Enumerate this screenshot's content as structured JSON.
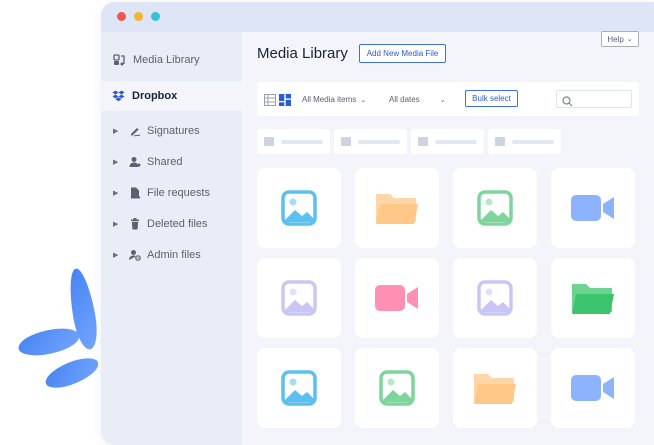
{
  "window": {
    "controls": [
      {
        "name": "close",
        "color": "#f5564a"
      },
      {
        "name": "minimize",
        "color": "#f3b62a"
      },
      {
        "name": "maximize",
        "color": "#35c2d8"
      }
    ]
  },
  "sidebar": {
    "items": [
      {
        "label": "Media Library",
        "icon": "media-library-icon",
        "active": false,
        "expandable": false
      },
      {
        "label": "Dropbox",
        "icon": "dropbox-icon",
        "active": true,
        "expandable": false
      },
      {
        "label": "Signatures",
        "icon": "signature-icon",
        "active": false,
        "expandable": true
      },
      {
        "label": "Shared",
        "icon": "shared-user-icon",
        "active": false,
        "expandable": true
      },
      {
        "label": "File requests",
        "icon": "file-request-icon",
        "active": false,
        "expandable": true
      },
      {
        "label": "Deleted files",
        "icon": "trash-icon",
        "active": false,
        "expandable": true
      },
      {
        "label": "Admin files",
        "icon": "admin-user-icon",
        "active": false,
        "expandable": true
      }
    ]
  },
  "header": {
    "title": "Media Library",
    "add_new_label": "Add New Media File",
    "help_label": "Help"
  },
  "toolbar": {
    "view_modes": [
      "list-view-icon",
      "grid-view-icon"
    ],
    "active_view": "grid",
    "media_filter": "All Media items",
    "date_filter": "All dates",
    "bulk_select_label": "Bulk select",
    "search_placeholder": ""
  },
  "folders": {
    "count": 4
  },
  "grid": {
    "tiles": [
      {
        "type": "image",
        "color": "#5bc0f0"
      },
      {
        "type": "folder",
        "color": "#ffc889"
      },
      {
        "type": "image",
        "color": "#7ed59b"
      },
      {
        "type": "video",
        "color": "#8db3ff"
      },
      {
        "type": "image",
        "color": "#c9c6f5"
      },
      {
        "type": "video",
        "color": "#ff8fb3"
      },
      {
        "type": "image",
        "color": "#c9c6f5"
      },
      {
        "type": "folder",
        "color": "#3cc46c"
      },
      {
        "type": "image",
        "color": "#5bc0f0"
      },
      {
        "type": "image",
        "color": "#7ed59b"
      },
      {
        "type": "folder",
        "color": "#ffc889"
      },
      {
        "type": "video",
        "color": "#8db3ff"
      }
    ]
  },
  "colors": {
    "accent": "#3d6fe0",
    "petal": "#3a7bf0"
  }
}
